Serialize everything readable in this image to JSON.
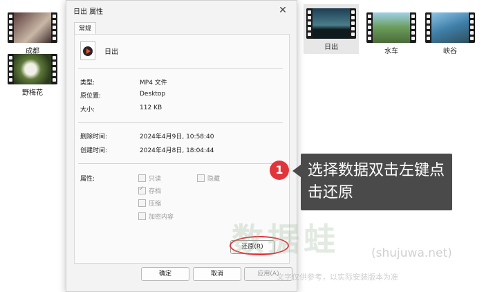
{
  "desktop": {
    "items": [
      {
        "label": "成都"
      },
      {
        "label": "野梅花"
      },
      {
        "label": "日出"
      },
      {
        "label": "水车"
      },
      {
        "label": "峡谷"
      }
    ]
  },
  "dialog": {
    "title": "日出 属性",
    "close_icon": "close-icon",
    "tab": "常规",
    "file_name": "日出",
    "fields": {
      "type_label": "类型:",
      "type_value": "MP4 文件",
      "location_label": "原位置:",
      "location_value": "Desktop",
      "size_label": "大小:",
      "size_value": "112 KB",
      "deleted_label": "删除时间:",
      "deleted_value": "2024年4月9日, 10:58:40",
      "created_label": "创建时间:",
      "created_value": "2024年4月8日, 18:04:44"
    },
    "attributes_label": "属性:",
    "attributes": {
      "readonly": "只读",
      "hidden": "隐藏",
      "archive": "存档",
      "compress": "压缩",
      "encrypt": "加密内容"
    },
    "restore_button": "还原(R)",
    "ok_button": "确定",
    "cancel_button": "取消",
    "apply_button": "应用(A)"
  },
  "callout": {
    "number": "1",
    "text": "选择数据双击左键点击还原"
  },
  "watermark": {
    "brand": "数据蛙",
    "url": "(shujuwa.net)",
    "note": "文字仅供参考，以实际安装版本为准"
  },
  "colors": {
    "accent_red": "#e0353b",
    "callout_bg": "#4a4a4a"
  }
}
